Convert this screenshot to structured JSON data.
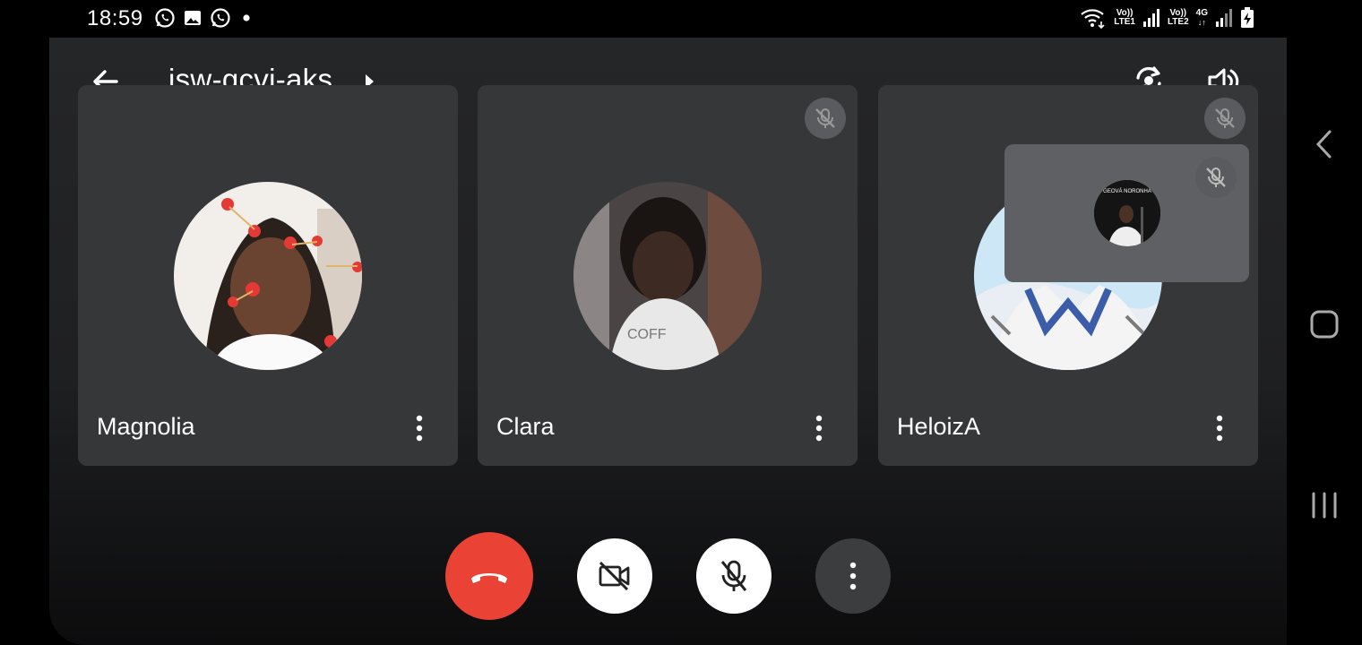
{
  "status_bar": {
    "time": "18:59",
    "left_icons": [
      "whatsapp-icon",
      "gallery-icon",
      "whatsapp-icon",
      "dot-icon"
    ],
    "sim1_label_top": "Vo))",
    "sim1_label_bottom": "LTE1",
    "sim2_label_top": "Vo))",
    "sim2_label_bottom": "LTE2",
    "network_type": "4G"
  },
  "meeting": {
    "code": "jsw-gcvj-aks",
    "top_actions": [
      "switch-camera-icon",
      "speaker-icon"
    ]
  },
  "participants": [
    {
      "name": "Magnolia",
      "muted": false
    },
    {
      "name": "Clara",
      "muted": true
    },
    {
      "name": "HeloizA",
      "muted": true
    }
  ],
  "self_view": {
    "avatar_caption": "GEOVÁ NORONHA",
    "muted": true
  },
  "controls": [
    "end-call",
    "camera-off",
    "mic-off",
    "more-options"
  ],
  "colors": {
    "end_call": "#ea4335",
    "tile_bg": "#363739",
    "control_light": "#ffffff",
    "control_dark": "#3c3d3f"
  },
  "nav_bar": [
    "back-icon",
    "home-icon",
    "recents-icon"
  ]
}
